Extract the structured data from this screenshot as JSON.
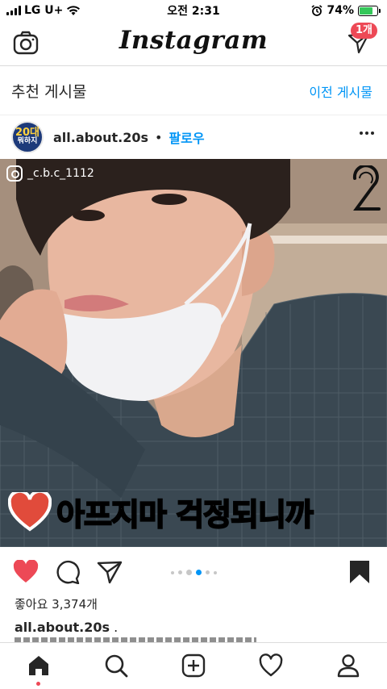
{
  "status_bar": {
    "carrier": "LG U+",
    "time": "오전 2:31",
    "battery_percent": "74%",
    "battery_level": 0.74
  },
  "header": {
    "logo": "Instagram",
    "dm_badge": "1개"
  },
  "suggested": {
    "title": "추천 게시물",
    "prev_link": "이전 게시물"
  },
  "post": {
    "avatar_text_top": "20대",
    "avatar_text_bottom": "뭐하지",
    "username": "all.about.20s",
    "separator": "•",
    "follow_label": "팔로우",
    "watermark": "_c.b.c_1112",
    "overlay_caption": "아프지마 걱정되니까",
    "likes": "좋아요 3,374개",
    "caption_username": "all.about.20s",
    "caption_text": ".",
    "carousel": {
      "count": 6,
      "active_index": 3
    },
    "liked": true,
    "saved": true
  },
  "colors": {
    "accent_blue": "#0095f6",
    "like_red": "#ed4956",
    "badge_red": "#ed4956"
  },
  "icons": {
    "camera": "camera-icon",
    "direct": "direct-message-icon",
    "heart": "heart-icon",
    "comment": "comment-icon",
    "share": "share-icon",
    "save": "bookmark-icon",
    "home": "home-icon",
    "search": "search-icon",
    "add": "add-post-icon",
    "activity": "activity-icon",
    "profile": "profile-icon"
  }
}
